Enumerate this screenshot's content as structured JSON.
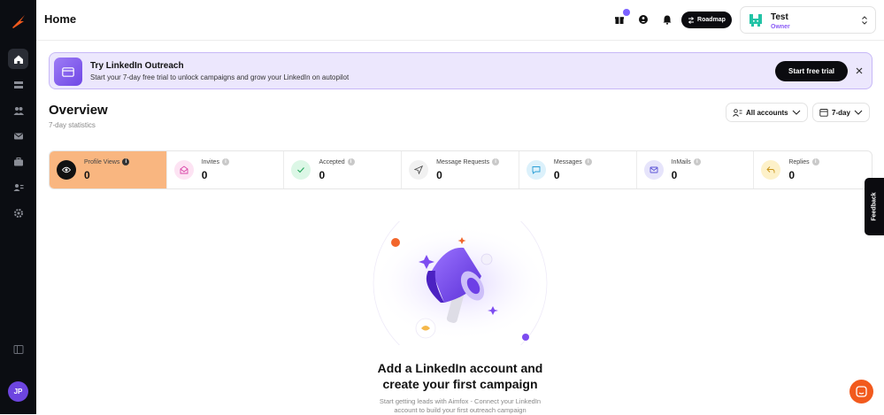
{
  "sidebar": {
    "nav_items": [
      {
        "name": "home-icon",
        "active": true
      },
      {
        "name": "campaigns-icon",
        "active": false
      },
      {
        "name": "leads-icon",
        "active": false
      },
      {
        "name": "inbox-icon",
        "active": false
      },
      {
        "name": "briefcase-icon",
        "active": false
      },
      {
        "name": "contacts-icon",
        "active": false
      },
      {
        "name": "settings-icon",
        "active": false
      }
    ],
    "avatar_initials": "JP"
  },
  "header": {
    "title": "Home",
    "roadmap_label": "Roadmap",
    "account": {
      "name": "Test",
      "role": "Owner"
    }
  },
  "banner": {
    "title": "Try LinkedIn Outreach",
    "subtitle": "Start your 7-day free trial to unlock campaigns and grow your LinkedIn on autopilot",
    "cta_label": "Start free trial"
  },
  "overview": {
    "title": "Overview",
    "subtitle": "7-day statistics",
    "accounts_filter": "All accounts",
    "period_filter": "7-day"
  },
  "stats": [
    {
      "label": "Profile Views",
      "value": "0",
      "icon": "eye-icon",
      "bg": "#111111",
      "fg": "#ffffff"
    },
    {
      "label": "Invites",
      "value": "0",
      "icon": "envelope-open-icon",
      "bg": "#fde3f3",
      "fg": "#d946a8"
    },
    {
      "label": "Accepted",
      "value": "0",
      "icon": "check-icon",
      "bg": "#dcf7e6",
      "fg": "#22a55a"
    },
    {
      "label": "Message Requests",
      "value": "0",
      "icon": "send-icon",
      "bg": "#f1f1f1",
      "fg": "#555555"
    },
    {
      "label": "Messages",
      "value": "0",
      "icon": "chat-bubble-icon",
      "bg": "#dcf1fb",
      "fg": "#2b9fd6"
    },
    {
      "label": "InMails",
      "value": "0",
      "icon": "mail-icon",
      "bg": "#e6e4fb",
      "fg": "#5b53d6"
    },
    {
      "label": "Replies",
      "value": "0",
      "icon": "reply-icon",
      "bg": "#fdf1c9",
      "fg": "#c9951a"
    }
  ],
  "feedback_label": "Feedback",
  "empty_state": {
    "title_line1": "Add a LinkedIn account and",
    "title_line2": "create your first campaign",
    "subtitle_line1": "Start getting leads with Aimfox - Connect your LinkedIn",
    "subtitle_line2": "account to build your first outreach campaign"
  },
  "colors": {
    "accent": "#7b61ff",
    "brand_orange": "#f25a1d",
    "active_stat": "#f9b680",
    "banner_bg": "#ece7fd"
  }
}
